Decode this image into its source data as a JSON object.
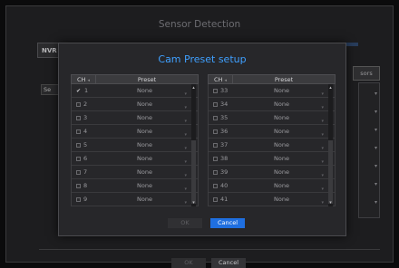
{
  "background_window": {
    "title": "Sensor Detection",
    "tab_nvr": "NVR",
    "right_button": "sors",
    "se_label": "Se",
    "ok_label": "OK",
    "cancel_label": "Cancel"
  },
  "dialog": {
    "title": "Cam Preset setup",
    "col_ch": "CH",
    "col_preset": "Preset",
    "ok_label": "OK",
    "cancel_label": "Cancel",
    "left_rows": [
      {
        "ch": "1",
        "preset": "None",
        "checked": true
      },
      {
        "ch": "2",
        "preset": "None",
        "checked": false
      },
      {
        "ch": "3",
        "preset": "None",
        "checked": false
      },
      {
        "ch": "4",
        "preset": "None",
        "checked": false
      },
      {
        "ch": "5",
        "preset": "None",
        "checked": false
      },
      {
        "ch": "6",
        "preset": "None",
        "checked": false
      },
      {
        "ch": "7",
        "preset": "None",
        "checked": false
      },
      {
        "ch": "8",
        "preset": "None",
        "checked": false
      },
      {
        "ch": "9",
        "preset": "None",
        "checked": false
      }
    ],
    "right_rows": [
      {
        "ch": "33",
        "preset": "None",
        "checked": false
      },
      {
        "ch": "34",
        "preset": "None",
        "checked": false
      },
      {
        "ch": "35",
        "preset": "None",
        "checked": false
      },
      {
        "ch": "36",
        "preset": "None",
        "checked": false
      },
      {
        "ch": "37",
        "preset": "None",
        "checked": false
      },
      {
        "ch": "38",
        "preset": "None",
        "checked": false
      },
      {
        "ch": "39",
        "preset": "None",
        "checked": false
      },
      {
        "ch": "40",
        "preset": "None",
        "checked": false
      },
      {
        "ch": "41",
        "preset": "None",
        "checked": false
      }
    ]
  },
  "colors": {
    "accent": "#1f6fe0",
    "title_blue": "#3fa0ff"
  }
}
